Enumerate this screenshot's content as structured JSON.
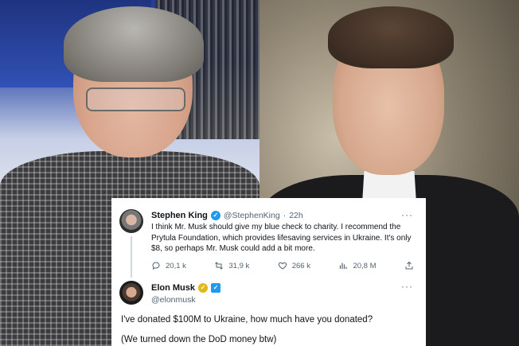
{
  "tweet1": {
    "name": "Stephen King",
    "handle": "@StephenKing",
    "time": "22h",
    "separator": "·",
    "text": "I think Mr. Musk should give my blue check to charity. I recommend the Prytula Foundation, which provides lifesaving services in Ukraine. It's only $8, so perhaps Mr. Musk could add a bit more.",
    "more": "···",
    "verified_icon": "verified-badge-icon",
    "stats": {
      "replies": "20,1 k",
      "retweets": "31,9 k",
      "likes": "266 k",
      "views": "20,8 M"
    }
  },
  "tweet2": {
    "name": "Elon Musk",
    "handle": "@elonmusk",
    "more": "···",
    "line1": "I've donated $100M to Ukraine, how much have you donated?",
    "line2": "(We turned down the DoD money btw)"
  },
  "colors": {
    "verified_blue": "#1d9bf0",
    "verified_gold": "#e2b719",
    "text_primary": "#0f1419",
    "text_secondary": "#536471"
  }
}
